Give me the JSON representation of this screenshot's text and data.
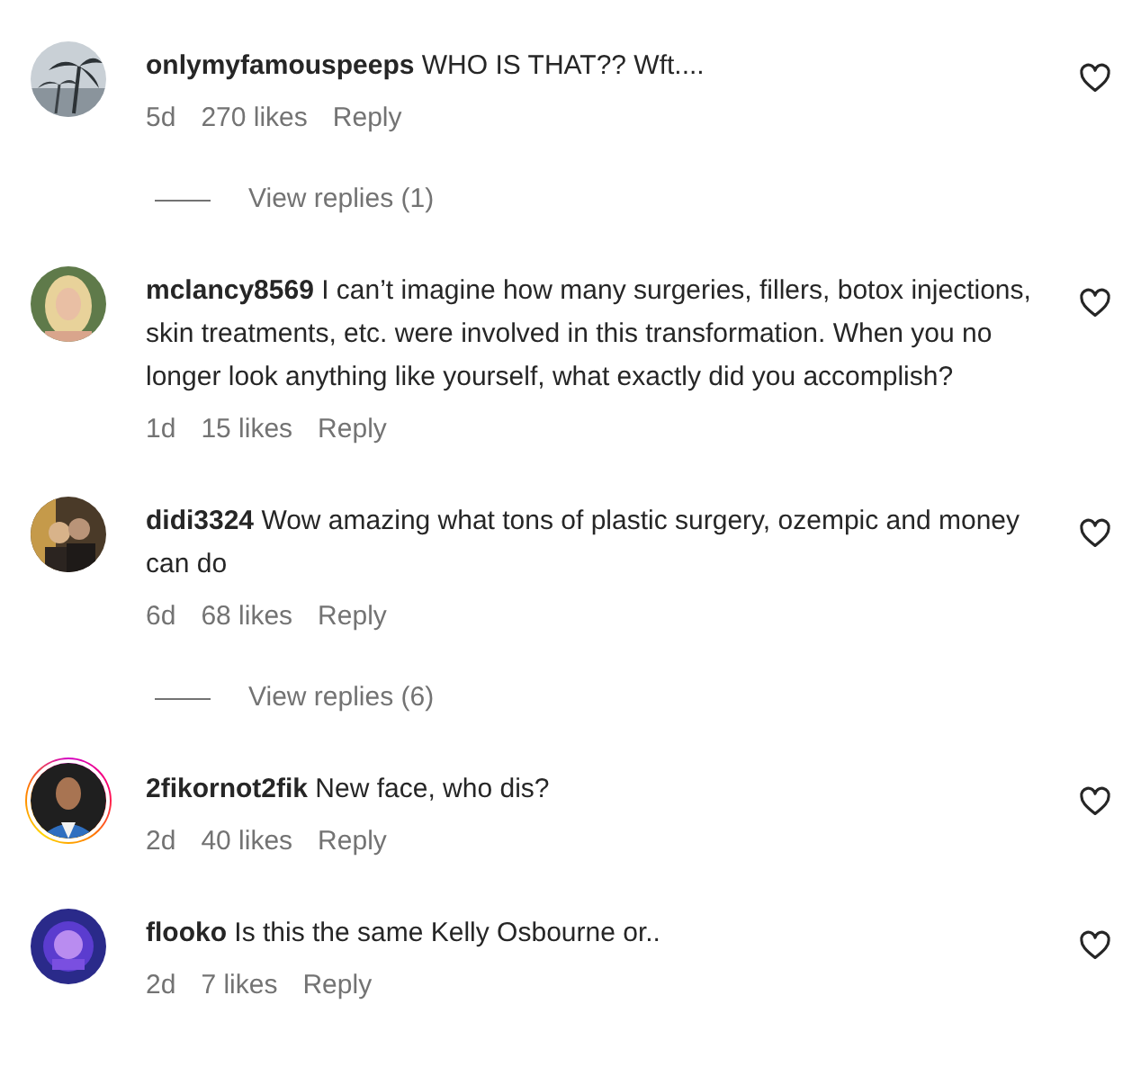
{
  "comments": [
    {
      "username": "onlymyfamouspeeps",
      "text": "WHO IS THAT?? Wft....",
      "time": "5d",
      "likes": "270 likes",
      "reply": "Reply",
      "story_ring": false,
      "view_replies": "View replies (1)"
    },
    {
      "username": "mclancy8569",
      "text": "I can’t imagine how many surgeries, fillers, botox injections, skin treatments, etc. were involved in this transformation. When you no longer look anything like yourself, what exactly did you accomplish?",
      "time": "1d",
      "likes": "15 likes",
      "reply": "Reply",
      "story_ring": false
    },
    {
      "username": "didi3324",
      "text": "Wow amazing what tons of plastic surgery, ozempic and money can do",
      "time": "6d",
      "likes": "68 likes",
      "reply": "Reply",
      "story_ring": false,
      "view_replies": "View replies (6)"
    },
    {
      "username": "2fikornot2fik",
      "text": "New face, who dis?",
      "time": "2d",
      "likes": "40 likes",
      "reply": "Reply",
      "story_ring": true
    },
    {
      "username": "flooko",
      "text": "Is this the same Kelly Osbourne or..",
      "time": "2d",
      "likes": "7 likes",
      "reply": "Reply",
      "story_ring": false
    }
  ]
}
